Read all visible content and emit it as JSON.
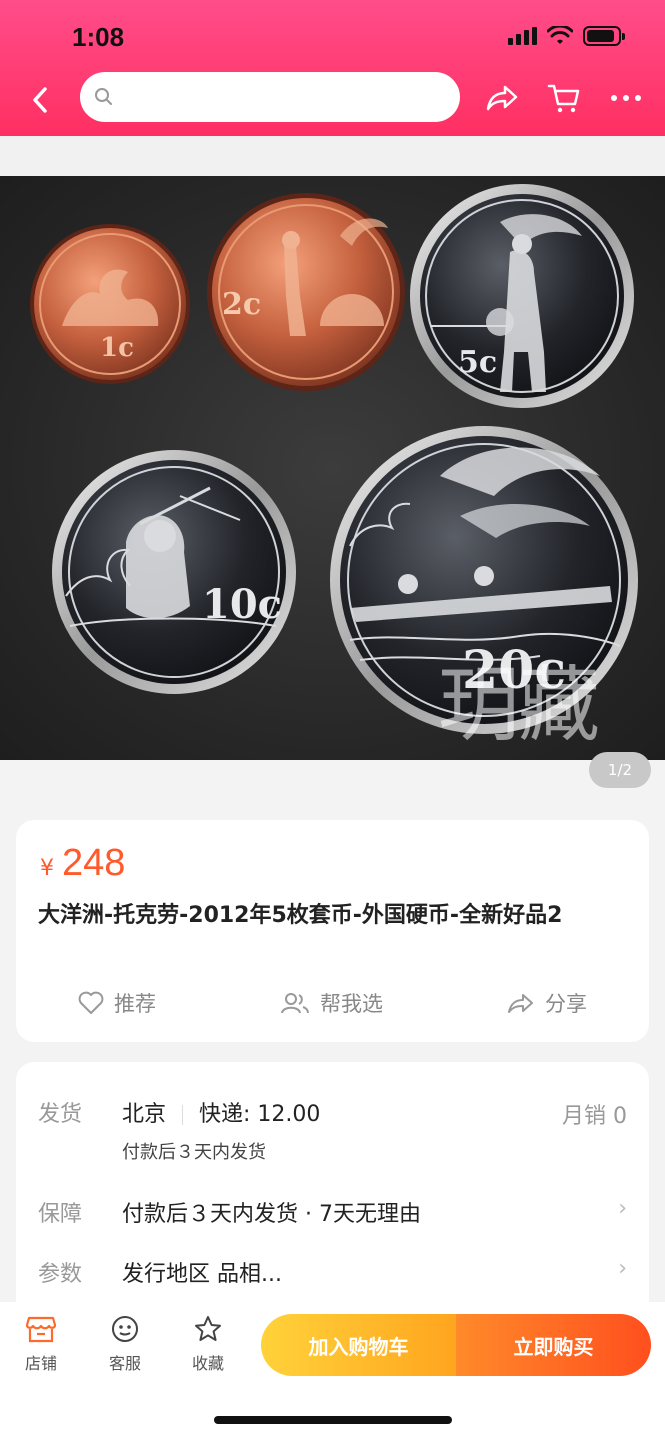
{
  "status_bar": {
    "time": "1:08"
  },
  "header": {
    "search_placeholder": ""
  },
  "gallery": {
    "watermark": "玥藏",
    "page_indicator": "1/2",
    "coins": [
      {
        "denomination": "1c"
      },
      {
        "denomination": "2c"
      },
      {
        "denomination": "5c"
      },
      {
        "denomination": "10c"
      },
      {
        "denomination": "20c"
      }
    ]
  },
  "product": {
    "price_symbol": "¥",
    "price": "248",
    "title": "大洋洲-托克劳-2012年5枚套币-外国硬币-全新好品2",
    "actions": {
      "recommend": "推荐",
      "help_choose": "帮我选",
      "share": "分享"
    }
  },
  "details": {
    "shipping_label": "发货",
    "shipping_city": "北京",
    "shipping_fee": "快递: 12.00",
    "shipping_note": "付款后３天内发货",
    "monthly_sales": "月销  0",
    "guarantee_label": "保障",
    "guarantee_value": "付款后３天内发货 · 7天无理由",
    "params_label": "参数",
    "params_value": "发行地区 品相..."
  },
  "bottom_bar": {
    "shop": "店铺",
    "service": "客服",
    "favorite": "收藏",
    "add_to_cart": "加入购物车",
    "buy_now": "立即购买"
  },
  "colors": {
    "header": "#ff2f62",
    "price": "#ff5a2a",
    "cart_button": "#ffb321",
    "buy_button": "#ff5a23"
  }
}
